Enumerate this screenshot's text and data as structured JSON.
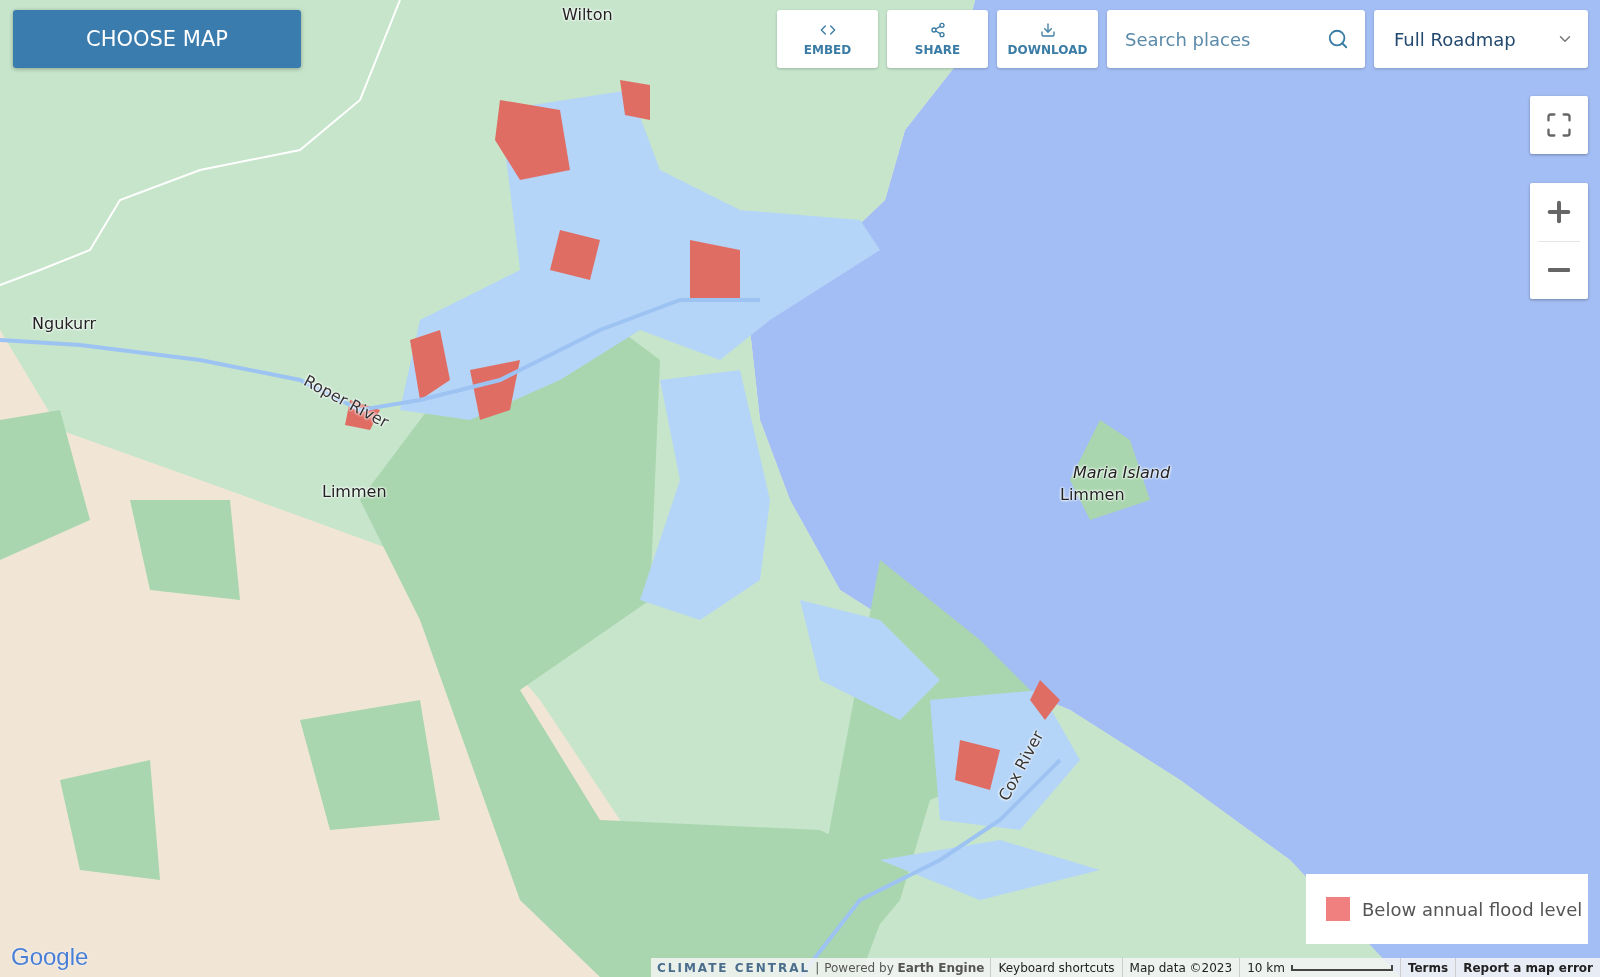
{
  "header": {
    "choose_map": "CHOOSE MAP"
  },
  "toolbar": [
    {
      "kind": "embed",
      "label": "EMBED"
    },
    {
      "kind": "share",
      "label": "SHARE"
    },
    {
      "kind": "download",
      "label": "DOWNLOAD"
    }
  ],
  "search": {
    "placeholder": "Search places"
  },
  "map_type": {
    "value": "Full Roadmap"
  },
  "map_labels": [
    {
      "text": "Wilton",
      "kind": "town"
    },
    {
      "text": "Ngukurr",
      "kind": "town"
    },
    {
      "text": "Roper River",
      "kind": "river"
    },
    {
      "text": "Limmen",
      "kind": "town"
    },
    {
      "text": "Maria Island",
      "kind": "island"
    },
    {
      "text": "Limmen",
      "kind": "town"
    },
    {
      "text": "Cox River",
      "kind": "river"
    }
  ],
  "legend": [
    {
      "label": "Below annual flood level",
      "color": "#f08080"
    }
  ],
  "google_logo": "Google",
  "footer": {
    "brand": "CLIMATE CENTRAL",
    "separator": "|",
    "powered": "Powered by **Earth Engine**",
    "shortcuts": "Keyboard shortcuts",
    "map_data": "Map data ©2023",
    "scale": "10 km",
    "terms": "Terms",
    "report": "Report a map error"
  }
}
